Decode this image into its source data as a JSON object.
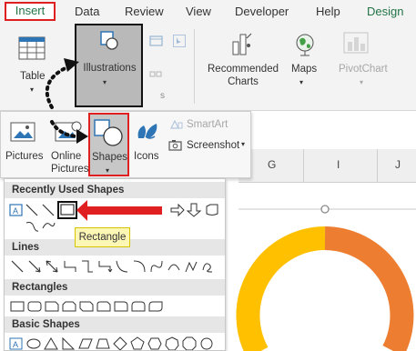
{
  "tabs": [
    "Insert",
    "Data",
    "Review",
    "View",
    "Developer",
    "Help",
    "Design"
  ],
  "ribbon": {
    "table": "Table",
    "illustrations": "Illustrations",
    "recommended_charts_line1": "Recommended",
    "recommended_charts_line2": "Charts",
    "maps": "Maps",
    "pivotchart": "PivotChart"
  },
  "illustrations_panel": {
    "pictures": "Pictures",
    "online_pictures_line1": "Online",
    "online_pictures_line2": "Pictures",
    "shapes": "Shapes",
    "icons": "Icons",
    "smartart": "SmartArt",
    "screenshot": "Screenshot"
  },
  "columns": [
    "G",
    "I",
    "J"
  ],
  "gallery": {
    "sections": [
      "Recently Used Shapes",
      "Lines",
      "Rectangles",
      "Basic Shapes"
    ]
  },
  "tooltip": "Rectangle",
  "colors": {
    "accent_green": "#217346",
    "highlight_red": "#e02020",
    "donut_orange": "#ed7d31",
    "donut_yellow": "#ffc000",
    "tooltip_yellow": "#fdf7b6"
  }
}
